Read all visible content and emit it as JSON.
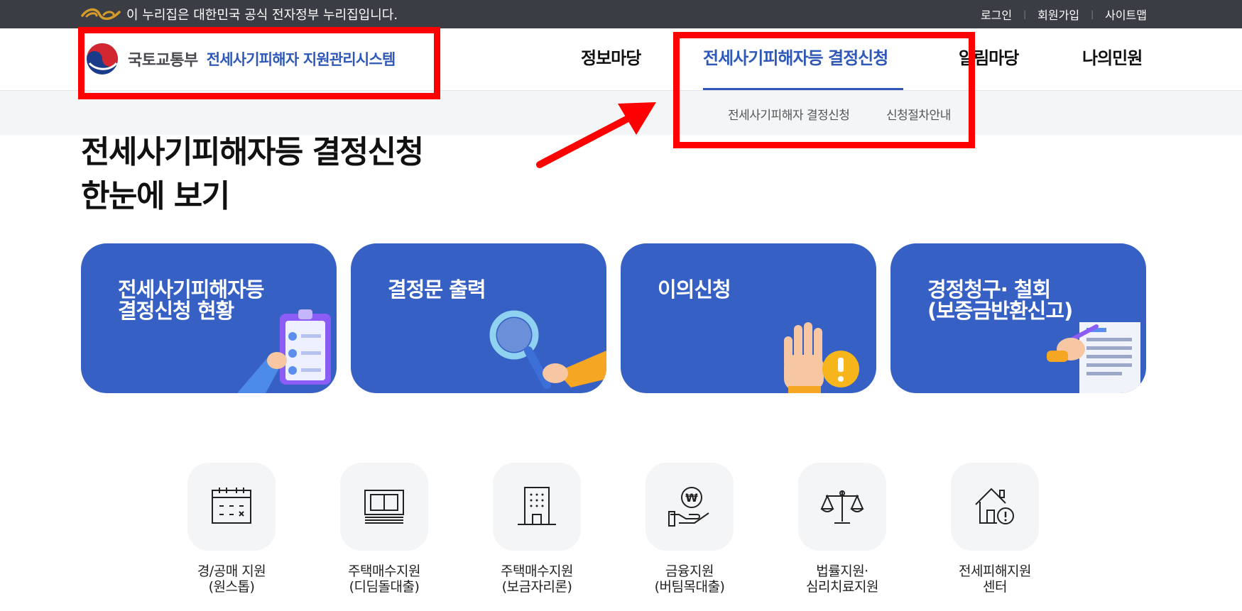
{
  "gov_banner": {
    "notice": "이 누리집은 대한민국 공식 전자정부 누리집입니다.",
    "links": [
      "로그인",
      "회원가입",
      "사이트맵"
    ]
  },
  "header": {
    "ministry": "국토교통부",
    "system_name": "전세사기피해자 지원관리시스템",
    "nav": [
      "정보마당",
      "전세사기피해자등 결정신청",
      "알림마당",
      "나의민원"
    ],
    "active_nav": "전세사기피해자등 결정신청",
    "sub_nav": [
      "전세사기피해자 결정신청",
      "신청절차안내"
    ]
  },
  "page": {
    "title_line1": "전세사기피해자등 결정신청",
    "title_line2": "한눈에 보기"
  },
  "cards": [
    {
      "title": "전세사기피해자등\n결정신청 현황",
      "icon": "clipboard-checklist-icon"
    },
    {
      "title": "결정문 출력",
      "icon": "magnifier-icon"
    },
    {
      "title": "이의신청",
      "icon": "raised-hand-alert-icon"
    },
    {
      "title": "경정청구· 철회\n(보증금반환신고)",
      "icon": "document-signing-icon"
    }
  ],
  "quick_links": [
    {
      "label": "경/공매 지원\n(원스톱)",
      "icon": "calendar-icon"
    },
    {
      "label": "주택매수지원\n(디딤돌대출)",
      "icon": "banknotes-icon"
    },
    {
      "label": "주택매수지원\n(보금자리론)",
      "icon": "building-icon"
    },
    {
      "label": "금융지원\n(버팀목대출)",
      "icon": "won-coin-hand-icon"
    },
    {
      "label": "법률지원·\n심리치료지원",
      "icon": "scales-icon"
    },
    {
      "label": "전세피해지원\n센터",
      "icon": "house-alert-icon"
    }
  ],
  "colors": {
    "accent": "#2f58b8",
    "card_bg": "#3660c4",
    "banner_bg": "#3b3d44",
    "annotation": "#ff0000"
  }
}
